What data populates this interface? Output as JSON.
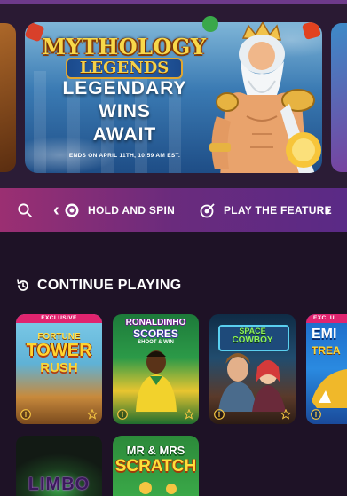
{
  "hero": {
    "logo_line1": "MYTHOLOGY",
    "logo_line2": "LEGENDS",
    "headline_1": "LEGENDARY",
    "headline_2": "WINS",
    "headline_3": "AWAIT",
    "subtext": "ENDS ON APRIL 11TH, 10:59 AM EST."
  },
  "categories": {
    "items": [
      {
        "label": "HOLD AND SPIN",
        "icon": "coin-icon"
      },
      {
        "label": "PLAY THE FEATURE",
        "icon": "target-icon"
      }
    ]
  },
  "section": {
    "title": "CONTINUE PLAYING",
    "icon": "history-icon"
  },
  "games": [
    {
      "title_1": "FORTUNE",
      "title_2": "TOWER",
      "title_3": "RUSH",
      "badge": "EXCLUSIVE"
    },
    {
      "title_1": "RONALDINHO",
      "title_2": "SCORES",
      "title_3": "SHOOT & WIN"
    },
    {
      "title_1": "SPACE",
      "title_2": "COWBOY"
    },
    {
      "title_1": "EMI",
      "title_2": "TREA",
      "badge": "EXCLU"
    },
    {
      "title_1": "LIMBO"
    },
    {
      "title_1": "MR & MRS",
      "title_2": "SCRATCH"
    }
  ],
  "colors": {
    "background": "#1e1226",
    "strip_start": "#9b2f72",
    "strip_end": "#5a2a86",
    "badge": "#e0246f",
    "star": "#f5c542"
  }
}
